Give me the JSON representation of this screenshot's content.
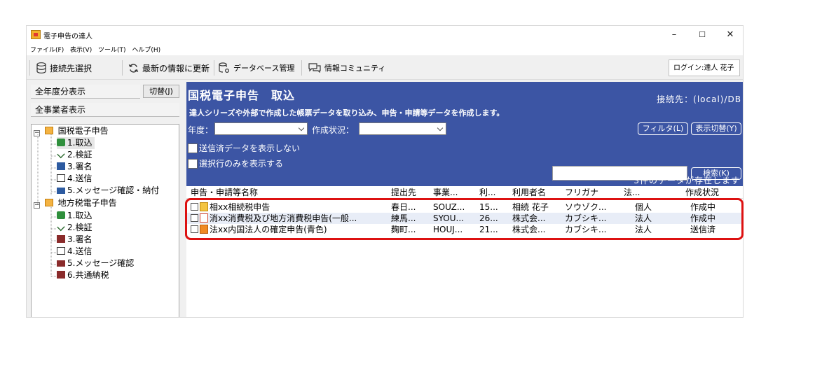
{
  "window": {
    "title": "電子申告の達人",
    "controls": {
      "minimize": "–",
      "maximize": "☐",
      "close": "✕"
    }
  },
  "menu": [
    "ファイル(F)",
    "表示(V)",
    "ツール(T)",
    "ヘルプ(H)"
  ],
  "toolbar": {
    "connect": "接続先選択",
    "refresh": "最新の情報に更新",
    "db": "データベース管理",
    "community": "情報コミュニティ",
    "login": "ログイン:達人 花子"
  },
  "left": {
    "all_years": "全年度分表示",
    "switch": "切替(J)",
    "all_business": "全事業者表示",
    "tree": {
      "national": {
        "label": "国税電子申告",
        "items": [
          "1.取込",
          "2.検証",
          "3.署名",
          "4.送信",
          "5.メッセージ確認・納付"
        ]
      },
      "local": {
        "label": "地方税電子申告",
        "items": [
          "1.取込",
          "2.検証",
          "3.署名",
          "4.送信",
          "5.メッセージ確認",
          "6.共通納税"
        ]
      }
    }
  },
  "panel": {
    "title": "国税電子申告　取込",
    "connection": "接続先：(local)/DB",
    "description": "達人シリーズや外部で作成した帳票データを取り込み、申告・申請等データを作成します。",
    "year_label": "年度：",
    "status_label": "作成状況：",
    "filter_btn": "フィルタ(L)",
    "display_switch_btn": "表示切替(Y)",
    "hide_sent": "送信済データを表示しない",
    "show_selected": "選択行のみを表示する",
    "search_btn": "検索(K)",
    "count": "3件のデータが存在します"
  },
  "table": {
    "headers": [
      "申告・申請等名称",
      "提出先",
      "事業...",
      "利...",
      "利用者名",
      "フリガナ",
      "法...",
      "作成状況"
    ],
    "rows": [
      [
        "相xx相続税申告",
        "春日...",
        "SOUZ...",
        "15...",
        "相続 花子",
        "ソウゾク...",
        "個人",
        "作成中"
      ],
      [
        "消xx消費税及び地方消費税申告(一般...",
        "練馬...",
        "SYOU...",
        "26...",
        "株式会...",
        "カブシキ...",
        "法人",
        "作成中"
      ],
      [
        "法xx内国法人の確定申告(青色)",
        "麹町...",
        "HOUJ...",
        "21...",
        "株式会...",
        "カブシキ...",
        "法人",
        "送信済"
      ]
    ]
  },
  "colors": {
    "panel": "#3c55a4",
    "highlight": "#dd1111",
    "alt_row": "#e8edf7"
  }
}
